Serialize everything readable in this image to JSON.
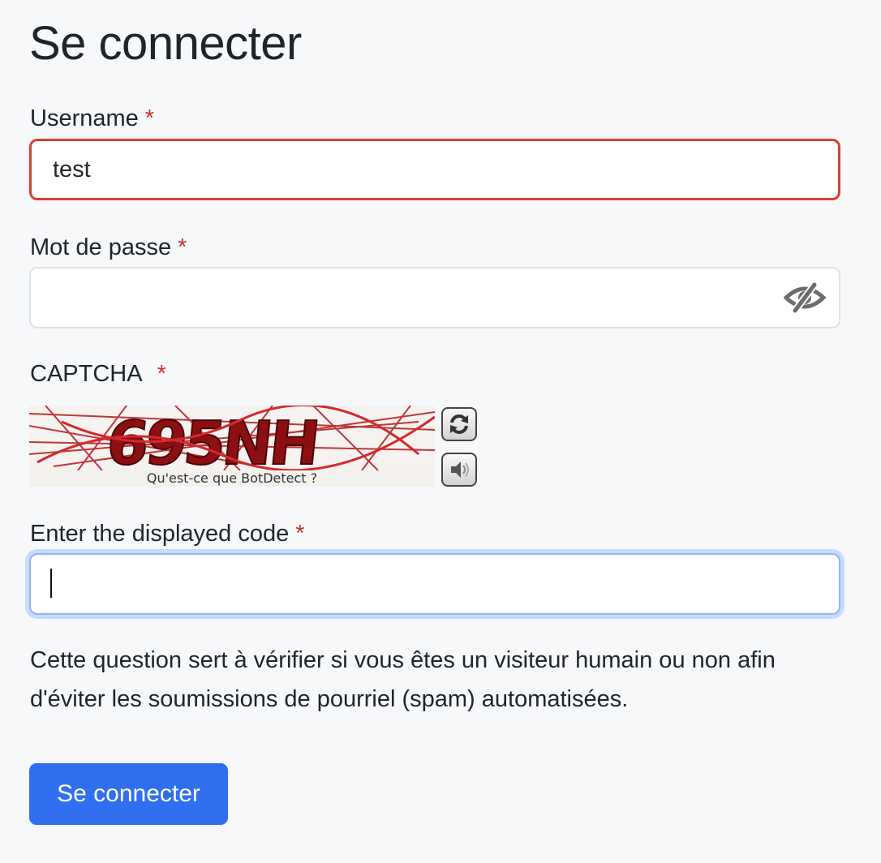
{
  "page_title": "Se connecter",
  "username": {
    "label": "Username",
    "required_mark": "*",
    "value": "test",
    "state_color": "#d9412c"
  },
  "password": {
    "label": "Mot de passe",
    "required_mark": "*",
    "value": "",
    "toggle_icon": "eye-slash-icon"
  },
  "captcha": {
    "label": "CAPTCHA",
    "required_mark": "*",
    "link_text": "Qu'est-ce que BotDetect ?",
    "reload_icon": "reload-icon",
    "sound_icon": "speaker-icon"
  },
  "code": {
    "label": "Enter the displayed code",
    "required_mark": "*",
    "value": "",
    "focus_color": "#8fb5f7"
  },
  "help_text": "Cette question sert à vérifier si vous êtes un visiteur humain ou non afin d'éviter les soumissions de pourriel (spam) automatisées.",
  "submit_label": "Se connecter",
  "colors": {
    "accent": "#2f6ff0",
    "required": "#d0312d",
    "background": "#f7f8fa"
  }
}
